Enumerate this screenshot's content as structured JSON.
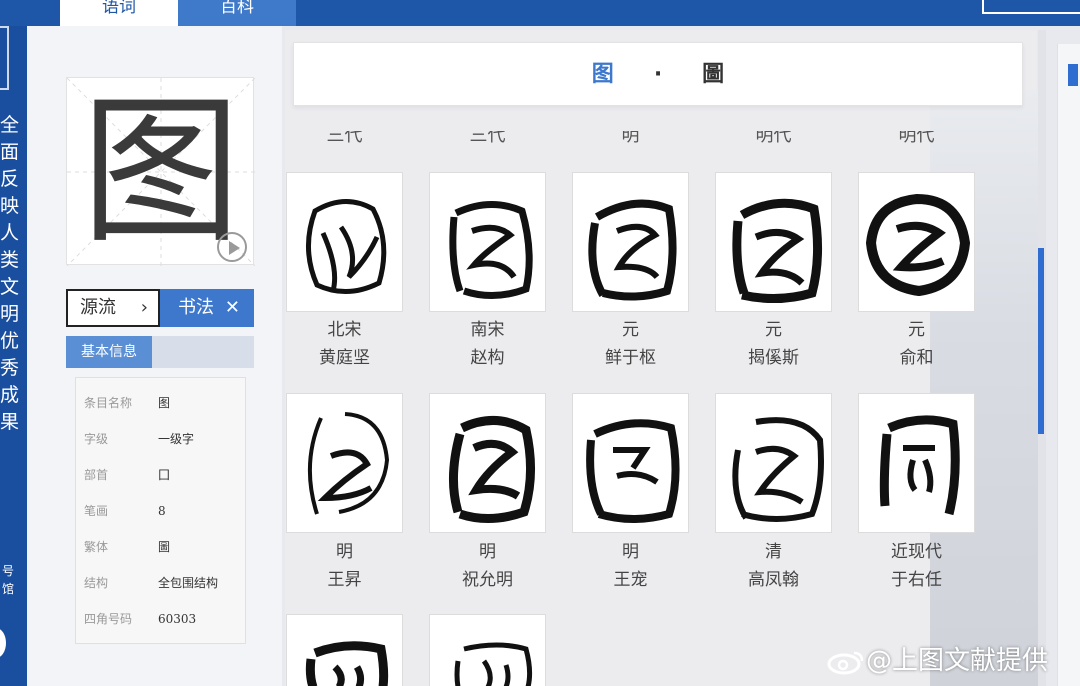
{
  "tabs": [
    {
      "label": "语词",
      "active": true
    },
    {
      "label": "百科",
      "active": false
    }
  ],
  "left_strip": {
    "vertical_text": "全面反映人类文明优秀成果",
    "small_text": "号馆"
  },
  "character": {
    "glyph": "图",
    "play_icon": "play-circle-icon"
  },
  "buttons": {
    "yuanliu": "源流",
    "yuanliu_chevron": "›",
    "shufa": "书法",
    "shufa_close": "✕"
  },
  "basic_info": {
    "tab_label": "基本信息",
    "rows": [
      {
        "key": "条目名称",
        "value": "图"
      },
      {
        "key": "字级",
        "value": "一级字"
      },
      {
        "key": "部首",
        "value": "囗"
      },
      {
        "key": "笔画",
        "value": "8"
      },
      {
        "key": "繁体",
        "value": "圖"
      },
      {
        "key": "结构",
        "value": "全包围结构"
      },
      {
        "key": "四角号码",
        "value": "60303"
      }
    ]
  },
  "title": {
    "simplified": "图",
    "separator": "·",
    "traditional": "圖"
  },
  "cutoff_captions": [
    "三代",
    "三代",
    "明",
    "明代",
    "明代"
  ],
  "calligraphy": [
    {
      "dynasty": "北宋",
      "author": "黄庭坚"
    },
    {
      "dynasty": "南宋",
      "author": "赵构"
    },
    {
      "dynasty": "元",
      "author": "鲜于枢"
    },
    {
      "dynasty": "元",
      "author": "揭傒斯"
    },
    {
      "dynasty": "元",
      "author": "俞和"
    },
    {
      "dynasty": "明",
      "author": "王昇"
    },
    {
      "dynasty": "明",
      "author": "祝允明"
    },
    {
      "dynasty": "明",
      "author": "王宠"
    },
    {
      "dynasty": "清",
      "author": "高凤翰"
    },
    {
      "dynasty": "近现代",
      "author": "于右任"
    }
  ],
  "watermark": "@上图文献提供",
  "colors": {
    "accent": "#1e56a8",
    "button_blue": "#3d78cc",
    "scroll_thumb": "#2f6ed0"
  }
}
